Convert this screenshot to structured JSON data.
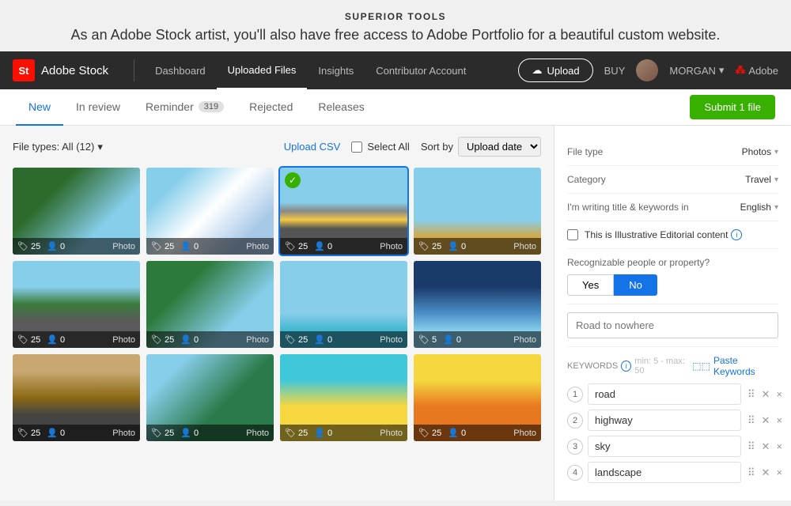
{
  "brand": "SUPERIOR TOOLS",
  "tagline": "As an Adobe Stock artist, you'll also have free access to Adobe Portfolio for a beautiful custom website.",
  "navbar": {
    "logo_text": "Adobe Stock",
    "logo_badge": "St",
    "links": [
      {
        "label": "Dashboard",
        "active": false
      },
      {
        "label": "Uploaded Files",
        "active": true
      },
      {
        "label": "Insights",
        "active": false
      },
      {
        "label": "Contributor Account",
        "active": false
      }
    ],
    "upload_label": "Upload",
    "buy_label": "BUY",
    "user_name": "MORGAN",
    "adobe_label": "Adobe"
  },
  "tabs": [
    {
      "label": "New",
      "active": true,
      "badge": null
    },
    {
      "label": "In review",
      "active": false,
      "badge": null
    },
    {
      "label": "Reminder",
      "active": false,
      "badge": "319"
    },
    {
      "label": "Rejected",
      "active": false,
      "badge": null
    },
    {
      "label": "Releases",
      "active": false,
      "badge": null
    }
  ],
  "submit_btn": "Submit 1 file",
  "file_types": "File types: All (12)",
  "upload_csv": "Upload CSV",
  "select_all": "Select All",
  "sort_label": "Sort by",
  "sort_value": "Upload date",
  "images": [
    {
      "id": 1,
      "bg": "img-bg-1",
      "keywords": 25,
      "people": 0,
      "type": "Photo"
    },
    {
      "id": 2,
      "bg": "img-bg-2",
      "keywords": 25,
      "people": 0,
      "type": "Photo"
    },
    {
      "id": 3,
      "bg": "img-bg-3",
      "keywords": 25,
      "people": 0,
      "type": "Photo",
      "selected": true
    },
    {
      "id": 4,
      "bg": "img-bg-4",
      "keywords": 25,
      "people": 0,
      "type": "Photo"
    },
    {
      "id": 5,
      "bg": "img-bg-5",
      "keywords": 25,
      "people": 0,
      "type": "Photo"
    },
    {
      "id": 6,
      "bg": "img-bg-6",
      "keywords": 25,
      "people": 0,
      "type": "Photo"
    },
    {
      "id": 7,
      "bg": "img-bg-7",
      "keywords": 25,
      "people": 0,
      "type": "Photo"
    },
    {
      "id": 8,
      "bg": "img-bg-8",
      "keywords": 5,
      "people": 0,
      "type": "Photo"
    },
    {
      "id": 9,
      "bg": "img-bg-9",
      "keywords": 25,
      "people": 0,
      "type": "Photo"
    },
    {
      "id": 10,
      "bg": "img-bg-10",
      "keywords": 25,
      "people": 0,
      "type": "Photo"
    },
    {
      "id": 11,
      "bg": "img-bg-11",
      "keywords": 25,
      "people": 0,
      "type": "Photo"
    },
    {
      "id": 12,
      "bg": "img-bg-12",
      "keywords": 25,
      "people": 0,
      "type": "Photo"
    }
  ],
  "right_panel": {
    "file_type_label": "File type",
    "file_type_value": "Photos",
    "category_label": "Category",
    "category_value": "Travel",
    "language_label": "I'm writing title & keywords in",
    "language_value": "English",
    "editorial_label": "This is Illustrative Editorial content",
    "recognizable_label": "Recognizable people or property?",
    "yes_label": "Yes",
    "no_label": "No",
    "title_placeholder": "Road to nowhere",
    "keywords_label": "KEYWORDS",
    "keywords_hint": "min: 5 - max: 50",
    "paste_keywords": "Paste Keywords",
    "keywords": [
      {
        "num": 1,
        "value": "road"
      },
      {
        "num": 2,
        "value": "highway"
      },
      {
        "num": 3,
        "value": "sky"
      },
      {
        "num": 4,
        "value": "landscape"
      }
    ]
  }
}
